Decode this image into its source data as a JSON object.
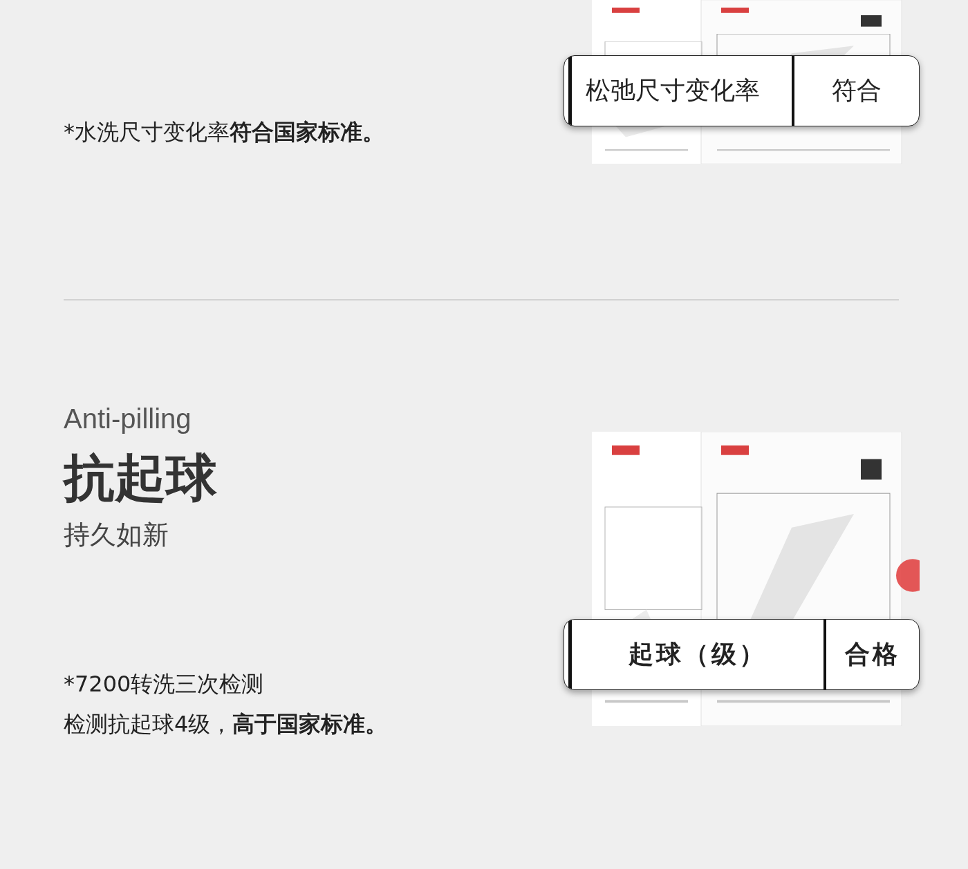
{
  "sections": [
    {
      "notes": [
        "*水洗尺寸变化率**符合国家标准。**"
      ],
      "report": {
        "kind": "picture",
        "callout": {
          "item": "松弛尺寸变化率",
          "result": "符合"
        }
      }
    },
    {
      "subtitle": "Anti-pilling",
      "title": "抗起球",
      "tagline": "持久如新",
      "notes": [
        "*7200转洗三次检测",
        "检测抗起球4级，**高于国家标准。**"
      ],
      "report": {
        "kind": "picture",
        "callout": {
          "item": "起球（级）",
          "result": "合格"
        }
      }
    }
  ]
}
